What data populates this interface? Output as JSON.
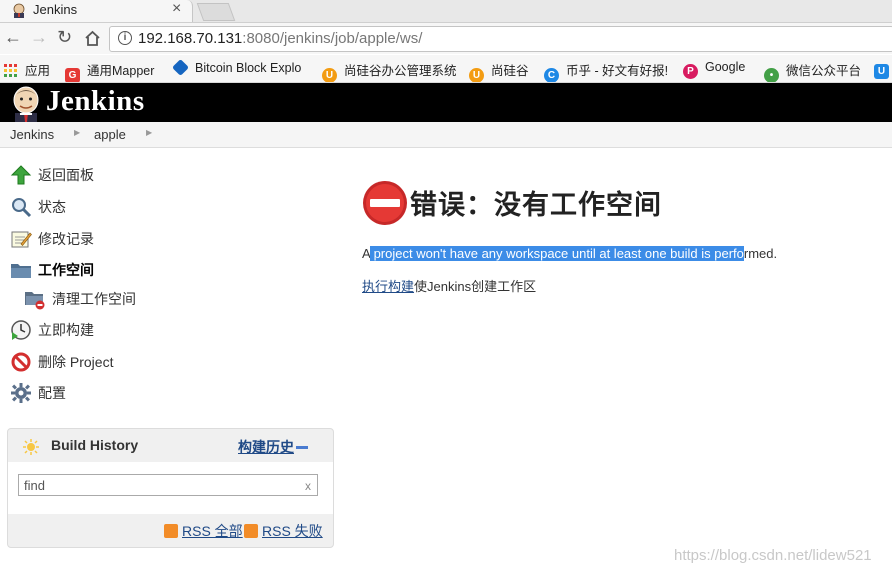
{
  "browser": {
    "tab_title": "Jenkins",
    "tab_close": "×",
    "url_host": "192.168.70.131",
    "url_rest": ":8080/jenkins/job/apple/ws/",
    "bookmarks": [
      {
        "label": "应用",
        "icon": "apps-grid-icon",
        "color": "#e53935"
      },
      {
        "label": "通用Mapper",
        "icon": "g-logo-icon",
        "color": "#e53935"
      },
      {
        "label": "Bitcoin Block Explo",
        "icon": "cube-icon",
        "color": "#1565c0"
      },
      {
        "label": "尚硅谷办公管理系统",
        "icon": "u-logo-icon",
        "color": "#f39c12"
      },
      {
        "label": "尚硅谷",
        "icon": "u-logo-icon",
        "color": "#f39c12"
      },
      {
        "label": "币乎 - 好文有好报!",
        "icon": "c-logo-icon",
        "color": "#1e88e5"
      },
      {
        "label": "Google",
        "icon": "p-logo-icon",
        "color": "#d81b60"
      },
      {
        "label": "微信公众平台",
        "icon": "wechat-icon",
        "color": "#43a047"
      },
      {
        "label": "",
        "icon": "u-blue-icon",
        "color": "#1e88e5"
      }
    ]
  },
  "header": {
    "title": "Jenkins"
  },
  "breadcrumb": {
    "items": [
      "Jenkins",
      "apple"
    ]
  },
  "sidebar": {
    "tasks": [
      {
        "label": "返回面板",
        "icon": "up-arrow-icon"
      },
      {
        "label": "状态",
        "icon": "magnifier-icon"
      },
      {
        "label": "修改记录",
        "icon": "notepad-icon"
      },
      {
        "label": "工作空间",
        "icon": "folder-icon"
      },
      {
        "label": "清理工作空间",
        "icon": "wipe-workspace-icon"
      },
      {
        "label": "立即构建",
        "icon": "clock-build-icon"
      },
      {
        "label": "删除 Project",
        "icon": "no-entry-icon"
      },
      {
        "label": "配置",
        "icon": "gear-icon"
      }
    ]
  },
  "build_history": {
    "title": "Build History",
    "link": "构建历史",
    "find_placeholder": "find",
    "clear": "x",
    "rss_all": "RSS 全部",
    "rss_failed": "RSS 失败"
  },
  "main": {
    "error_title": "错误：没有工作空间",
    "msg_pre": "A",
    "msg_selected": " project won't have any workspace until at least one build is perfo",
    "msg_post": "rmed.",
    "build_link": "执行构建",
    "build_suffix": "使Jenkins创建工作区"
  },
  "watermark": "https://blog.csdn.net/lidew521"
}
